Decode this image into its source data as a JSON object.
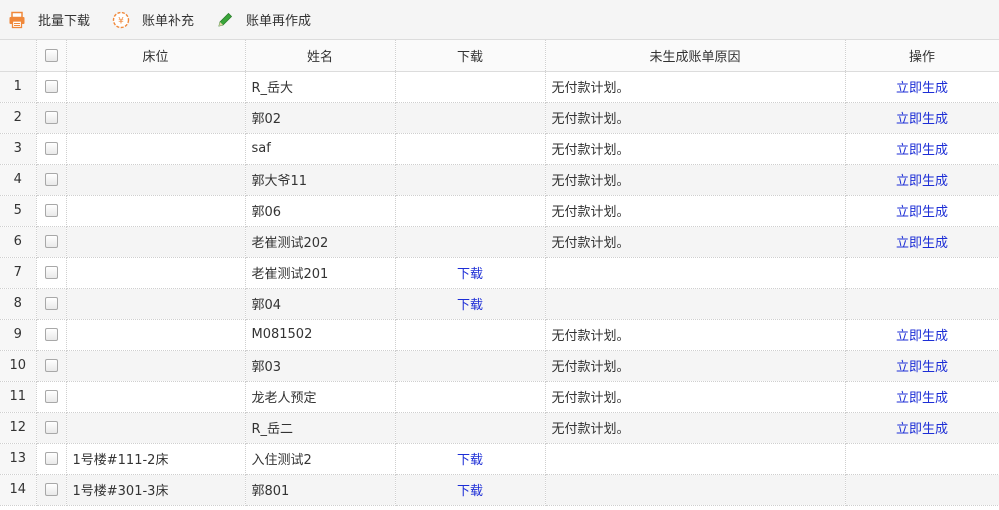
{
  "toolbar": {
    "batch_download": "批量下载",
    "bill_supplement": "账单补充",
    "bill_regenerate": "账单再作成"
  },
  "columns": {
    "bed": "床位",
    "name": "姓名",
    "download": "下载",
    "reason": "未生成账单原因",
    "action": "操作"
  },
  "rows": [
    {
      "no": "1",
      "bed": "",
      "name": "R_岳大",
      "download": "",
      "reason": "无付款计划。",
      "action": "立即生成"
    },
    {
      "no": "2",
      "bed": "",
      "name": "郭02",
      "download": "",
      "reason": "无付款计划。",
      "action": "立即生成"
    },
    {
      "no": "3",
      "bed": "",
      "name": "saf",
      "download": "",
      "reason": "无付款计划。",
      "action": "立即生成"
    },
    {
      "no": "4",
      "bed": "",
      "name": "郭大爷11",
      "download": "",
      "reason": "无付款计划。",
      "action": "立即生成"
    },
    {
      "no": "5",
      "bed": "",
      "name": "郭06",
      "download": "",
      "reason": "无付款计划。",
      "action": "立即生成"
    },
    {
      "no": "6",
      "bed": "",
      "name": "老崔测试202",
      "download": "",
      "reason": "无付款计划。",
      "action": "立即生成"
    },
    {
      "no": "7",
      "bed": "",
      "name": "老崔测试201",
      "download": "下载",
      "reason": "",
      "action": ""
    },
    {
      "no": "8",
      "bed": "",
      "name": "郭04",
      "download": "下载",
      "reason": "",
      "action": ""
    },
    {
      "no": "9",
      "bed": "",
      "name": "M081502",
      "download": "",
      "reason": "无付款计划。",
      "action": "立即生成"
    },
    {
      "no": "10",
      "bed": "",
      "name": "郭03",
      "download": "",
      "reason": "无付款计划。",
      "action": "立即生成"
    },
    {
      "no": "11",
      "bed": "",
      "name": "龙老人预定",
      "download": "",
      "reason": "无付款计划。",
      "action": "立即生成"
    },
    {
      "no": "12",
      "bed": "",
      "name": "R_岳二",
      "download": "",
      "reason": "无付款计划。",
      "action": "立即生成"
    },
    {
      "no": "13",
      "bed": "1号楼#111-2床",
      "name": "入住测试2",
      "download": "下载",
      "reason": "",
      "action": ""
    },
    {
      "no": "14",
      "bed": "1号楼#301-3床",
      "name": "郭801",
      "download": "下载",
      "reason": "",
      "action": ""
    }
  ],
  "icons": {
    "batch_download": "printer-icon",
    "bill_supplement": "yen-coin-icon",
    "bill_regenerate": "pencil-icon"
  },
  "colors": {
    "link": "#1d2ed6",
    "printer": "#f0883a",
    "yen": "#f0883a",
    "pencil": "#3aa63a"
  }
}
